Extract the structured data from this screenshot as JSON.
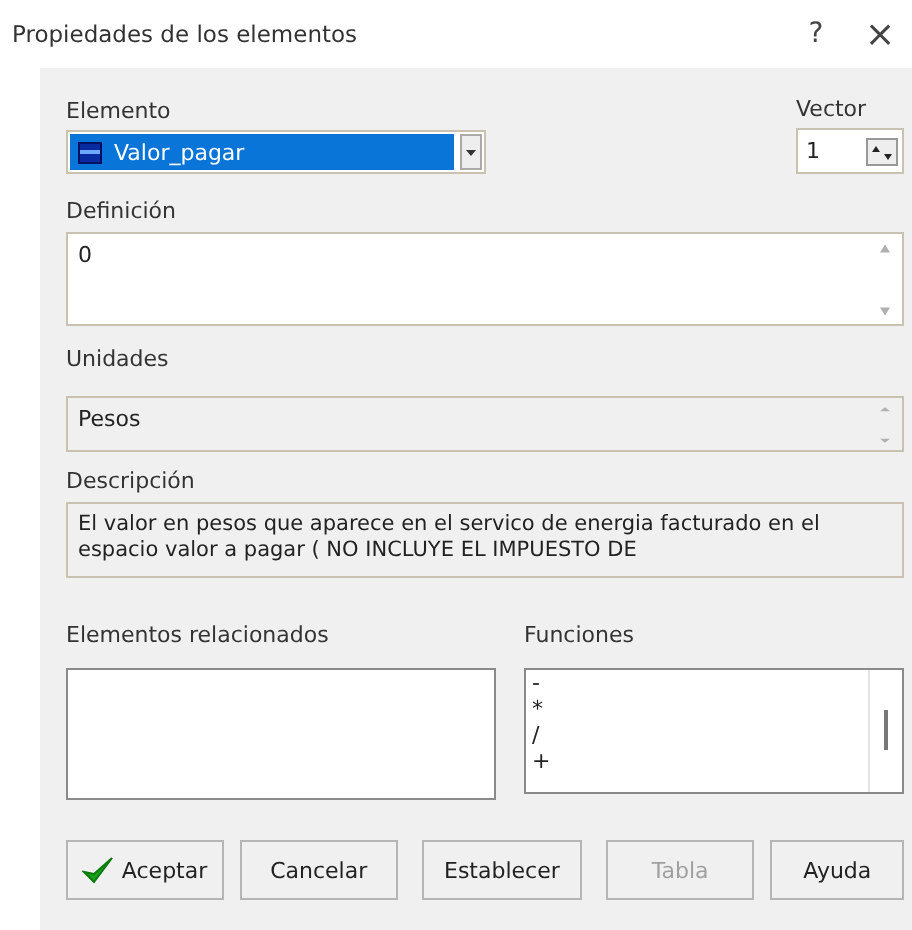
{
  "window": {
    "title": "Propiedades de los elementos",
    "help": "?",
    "close": "×"
  },
  "elemento": {
    "label": "Elemento",
    "value": "Valor_pagar"
  },
  "vector": {
    "label": "Vector",
    "value": "1"
  },
  "definicion": {
    "label": "Definición",
    "value": "0"
  },
  "unidades": {
    "label": "Unidades",
    "value": "Pesos"
  },
  "descripcion": {
    "label": "Descripción",
    "value": "El valor en pesos que aparece  en el servico de energia facturado en el espacio valor a pagar ( NO INCLUYE EL IMPUESTO DE"
  },
  "elementos_relacionados": {
    "label": "Elementos relacionados"
  },
  "funciones": {
    "label": "Funciones",
    "items": [
      "-",
      "*",
      "/",
      "+"
    ]
  },
  "buttons": [
    {
      "label": "Aceptar",
      "kind": "ok",
      "disabled": false
    },
    {
      "label": "Cancelar",
      "kind": "plain",
      "disabled": false
    },
    {
      "label": "Establecer",
      "kind": "plain",
      "disabled": false
    },
    {
      "label": "Tabla",
      "kind": "plain",
      "disabled": true
    },
    {
      "label": "Ayuda",
      "kind": "plain",
      "disabled": false
    }
  ]
}
